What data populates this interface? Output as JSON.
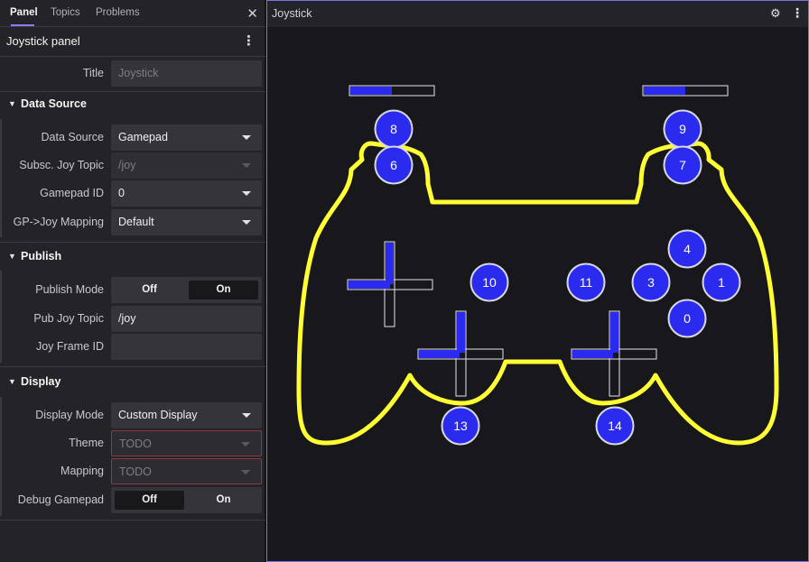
{
  "tabs": [
    {
      "label": "Panel",
      "active": true
    },
    {
      "label": "Topics",
      "active": false
    },
    {
      "label": "Problems",
      "active": false
    }
  ],
  "close_icon": "close-icon",
  "panel_title": "Joystick panel",
  "title_field": {
    "label": "Title",
    "placeholder": "Joystick"
  },
  "sections": {
    "data_source": "Data Source",
    "publish": "Publish",
    "display": "Display"
  },
  "data_source": {
    "data_source": {
      "label": "Data Source",
      "value": "Gamepad"
    },
    "subsc_topic": {
      "label": "Subsc. Joy Topic",
      "value": "/joy"
    },
    "gamepad_id": {
      "label": "Gamepad ID",
      "value": "0"
    },
    "gp_joy_mapping": {
      "label": "GP->Joy Mapping",
      "value": "Default"
    }
  },
  "publish": {
    "publish_mode": {
      "label": "Publish Mode",
      "options": [
        "Off",
        "On"
      ],
      "selected": "On"
    },
    "pub_topic": {
      "label": "Pub Joy Topic",
      "value": "/joy"
    },
    "frame_id": {
      "label": "Joy Frame ID",
      "value": ""
    }
  },
  "display": {
    "display_mode": {
      "label": "Display Mode",
      "value": "Custom Display"
    },
    "theme": {
      "label": "Theme",
      "value": "TODO"
    },
    "mapping": {
      "label": "Mapping",
      "value": "TODO"
    },
    "debug_gamepad": {
      "label": "Debug Gamepad",
      "options": [
        "Off",
        "On"
      ],
      "selected": "Off"
    }
  },
  "viewer": {
    "title": "Joystick",
    "icons": [
      "gear-icon",
      "kebab-menu-icon"
    ],
    "colors": {
      "outline": "#ffff33",
      "button": "#2b2bf0",
      "background": "#18181c"
    },
    "triggers": [
      {
        "name": "left-trigger",
        "fill_fraction": 0.5
      },
      {
        "name": "right-trigger",
        "fill_fraction": 0.5
      }
    ],
    "buttons": [
      "8",
      "9",
      "6",
      "7",
      "4",
      "10",
      "11",
      "3",
      "1",
      "0",
      "13",
      "14"
    ]
  }
}
